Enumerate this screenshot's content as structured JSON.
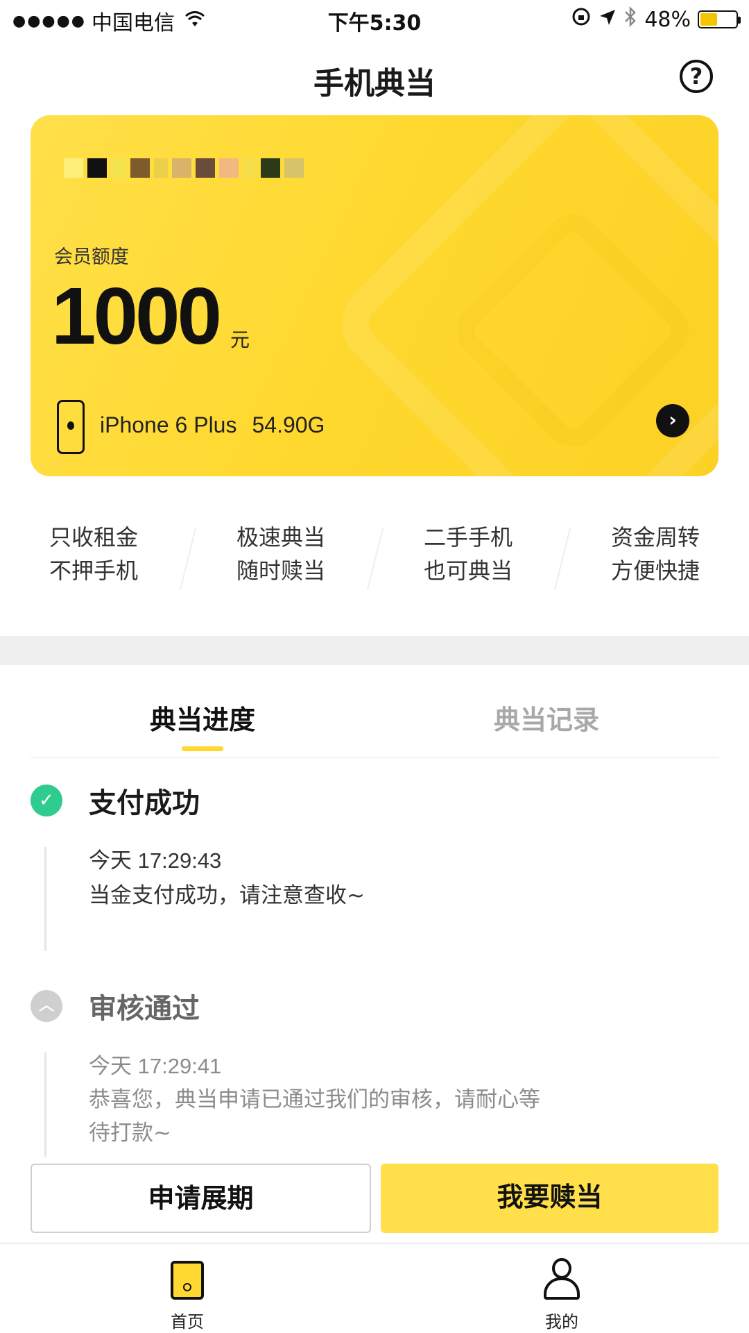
{
  "status_bar": {
    "signal": "●●●●●",
    "carrier": "中国电信",
    "wifi_icon": "wifi-icon",
    "time": "下午5:30",
    "battery_percent": "48%",
    "battery_level": 0.48,
    "battery_color": "#f5c400"
  },
  "header": {
    "title": "手机典当",
    "help_icon": "?"
  },
  "card": {
    "credit_label": "会员额度",
    "credit_amount": "1000",
    "credit_unit": "元",
    "device_model": "iPhone 6 Plus",
    "device_storage": "54.90G",
    "arrow": "›",
    "accent_color": "#ffd930"
  },
  "features": [
    {
      "line1": "只收租金",
      "line2": "不押手机"
    },
    {
      "line1": "极速典当",
      "line2": "随时赎当"
    },
    {
      "line1": "二手手机",
      "line2": "也可典当"
    },
    {
      "line1": "资金周转",
      "line2": "方便快捷"
    }
  ],
  "tabs": [
    {
      "label": "典当进度",
      "active": true
    },
    {
      "label": "典当记录",
      "active": false
    }
  ],
  "timeline": [
    {
      "status": "done",
      "icon": "✓",
      "title": "支付成功",
      "time": "今天 17:29:43",
      "desc": "当金支付成功，请注意查收~",
      "status_color": "#2ecc8e"
    },
    {
      "status": "pending",
      "icon": "︿",
      "title": "审核通过",
      "time": "今天 17:29:41",
      "desc": "恭喜您，典当申请已通过我们的审核，请耐心等待打款~"
    }
  ],
  "actions": {
    "extend_label": "申请展期",
    "redeem_label": "我要赎当"
  },
  "tab_bar": {
    "home_label": "首页",
    "mine_label": "我的"
  }
}
